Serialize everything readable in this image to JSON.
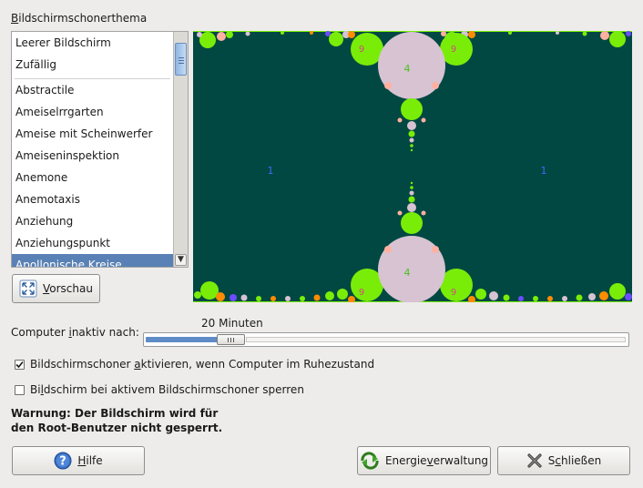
{
  "theme_section": {
    "title": "Bildschirmschonerthema"
  },
  "theme_list": {
    "items": [
      "Leerer Bildschirm",
      "Zufällig",
      "Abstractile",
      "Ameiselrrgarten",
      "Ameise mit Scheinwerfer",
      "Ameiseninspektion",
      "Anemone",
      "Anemotaxis",
      "Anziehung",
      "Anziehungspunkt",
      "Apollonische Kreise"
    ],
    "selected": "Apollonische Kreise"
  },
  "preview": {
    "button_label": "Vorschau",
    "circle_labels": [
      "1",
      "1",
      "4",
      "4",
      "9",
      "9",
      "9",
      "9"
    ]
  },
  "idle": {
    "label": "Computer inaktiv nach:",
    "value_text": "20 Minuten",
    "slider_fraction": 0.18
  },
  "options": {
    "activate_label": "Bildschirmschoner aktivieren, wenn Computer im Ruhezustand",
    "activate_checked": true,
    "lock_label": "Bildschirm bei aktivem Bildschirmschoner sperren",
    "lock_checked": false
  },
  "warning": {
    "line1": "Warnung: Der Bildschirm wird für",
    "line2": "den Root-Benutzer nicht gesperrt."
  },
  "buttons": {
    "help": "Hilfe",
    "power": "Energieverwaltung",
    "close": "Schließen"
  },
  "icons": {
    "preview": "fullscreen-icon",
    "help": "help-icon",
    "power": "power-management-icon",
    "close": "close-icon"
  },
  "colors": {
    "selection": "#5981b5",
    "preview_background": "#014842",
    "big_circle": "#d7c3d2",
    "green_circle": "#79ed08"
  }
}
